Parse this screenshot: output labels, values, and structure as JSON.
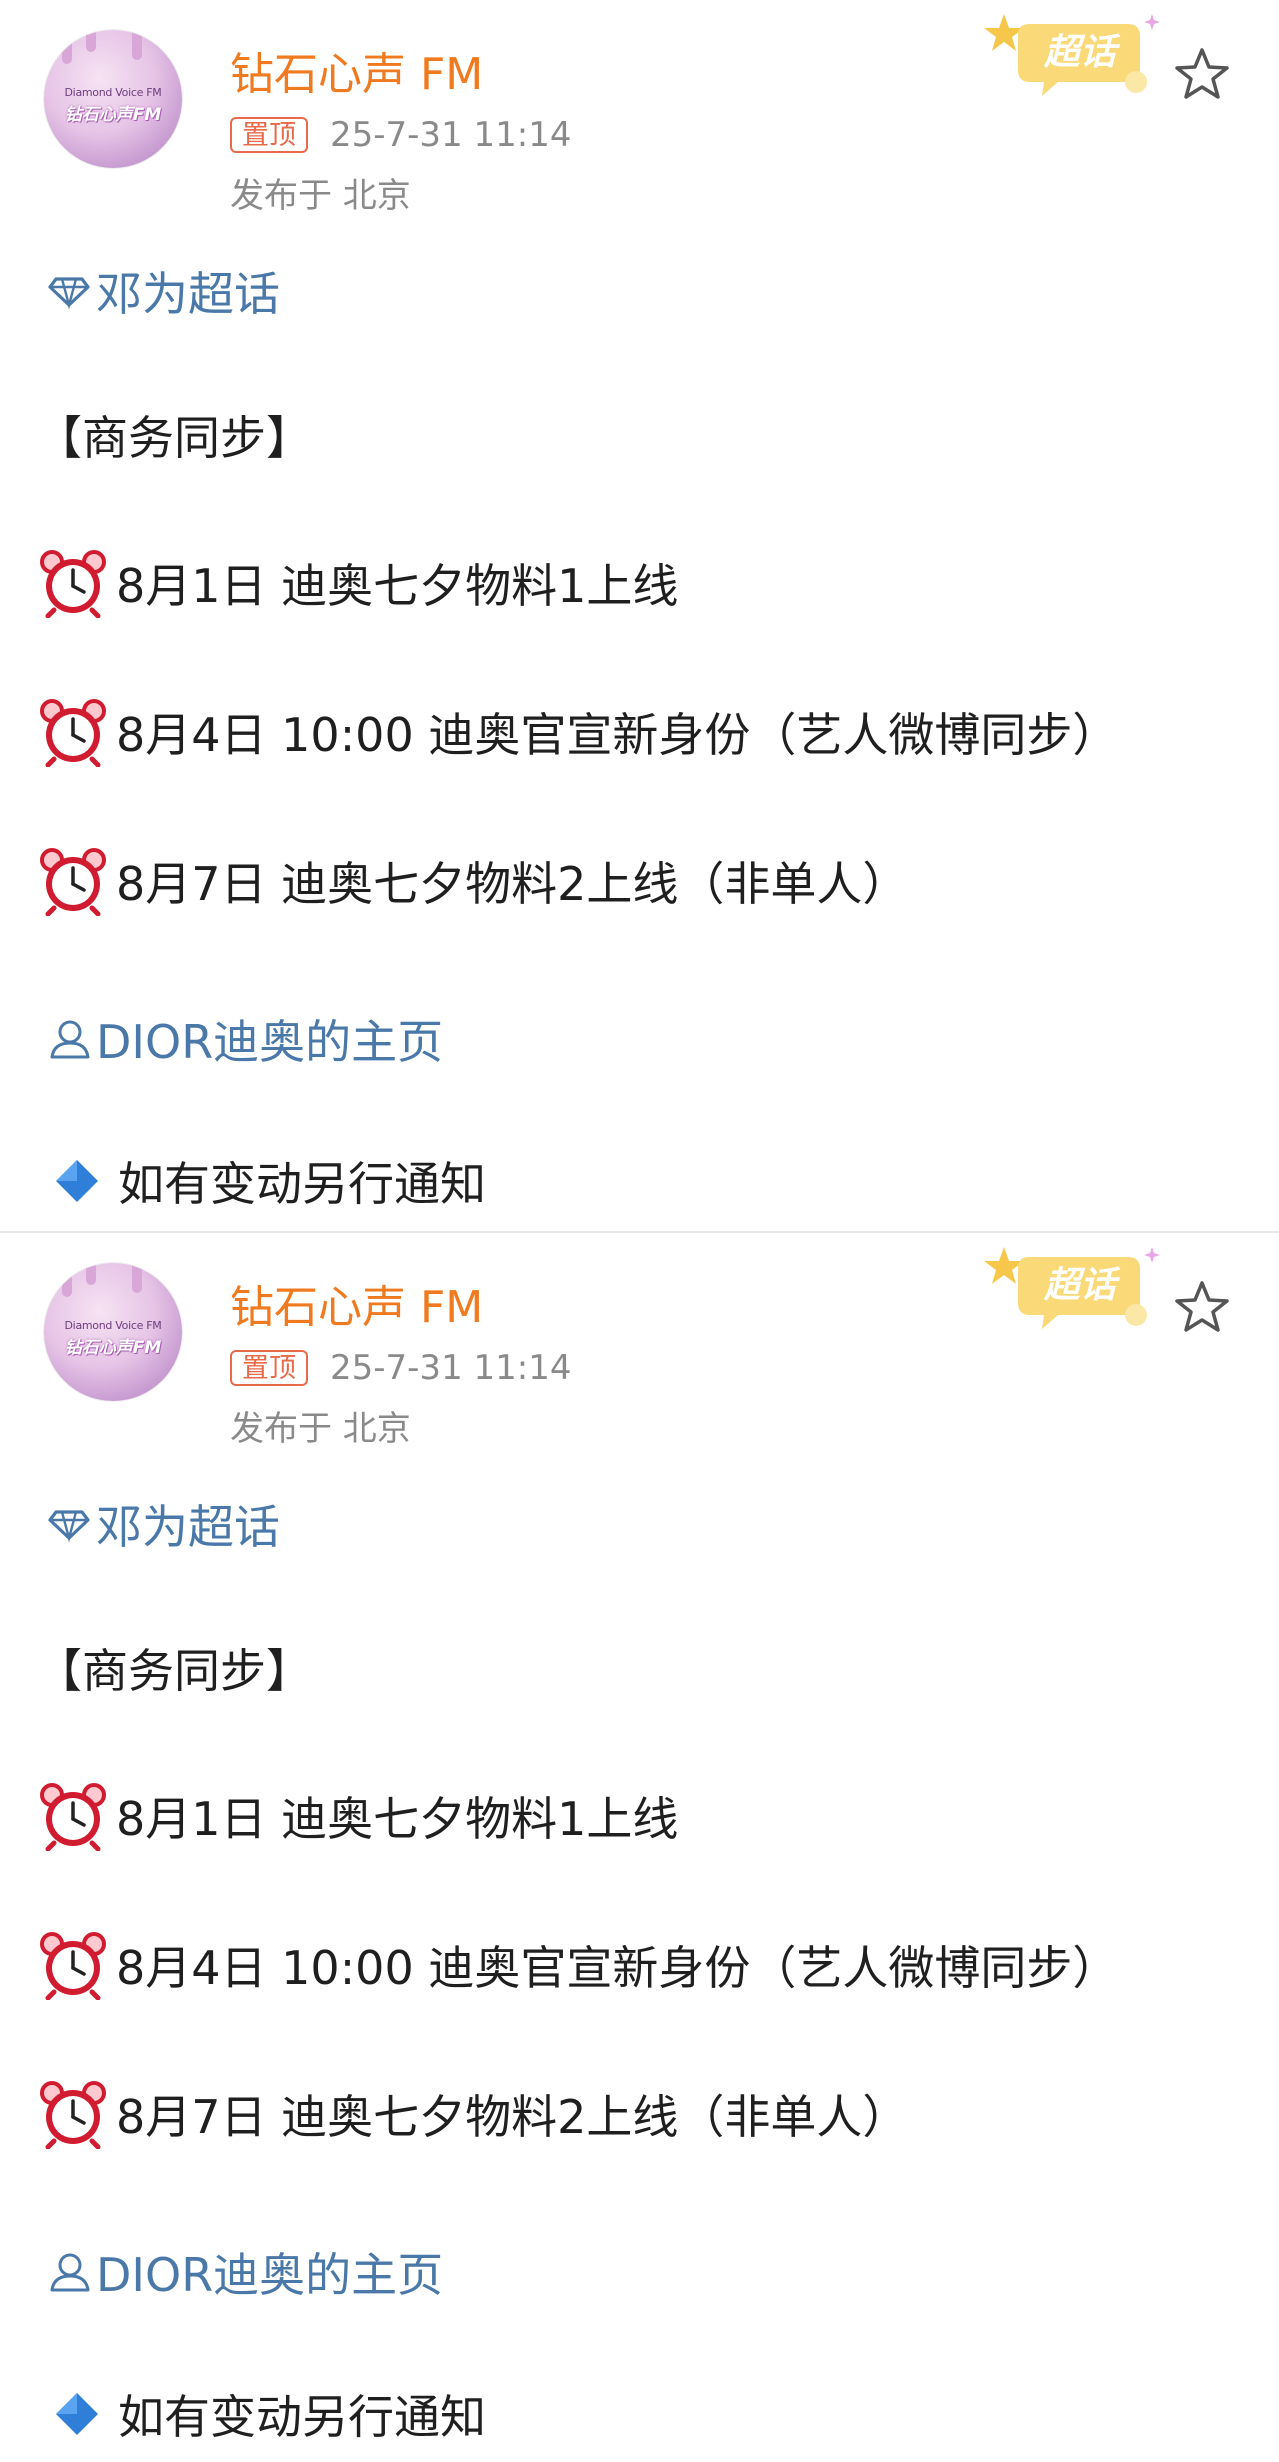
{
  "posts": [
    {
      "author": {
        "name": "钻石心声 FM",
        "avatar_line1": "Diamond Voice FM",
        "avatar_line2": "钻石心声FM"
      },
      "pin_label": "置顶",
      "timestamp": "25-7-31 11:14",
      "location": "发布于 北京",
      "badge_label": "超话",
      "topic": "邓为超话",
      "header": "【商务同步】",
      "schedule": [
        {
          "text": "8月1日 迪奥七夕物料1上线"
        },
        {
          "text": "8月4日 10:00 迪奥官宣新身份（艺人微博同步）"
        },
        {
          "text": "8月7日 迪奥七夕物料2上线（非单人）"
        }
      ],
      "profile_link": "DIOR迪奥的主页",
      "notice": "如有变动另行通知"
    },
    {
      "author": {
        "name": "钻石心声 FM",
        "avatar_line1": "Diamond Voice FM",
        "avatar_line2": "钻石心声FM"
      },
      "pin_label": "置顶",
      "timestamp": "25-7-31 11:14",
      "location": "发布于 北京",
      "badge_label": "超话",
      "topic": "邓为超话",
      "header": "【商务同步】",
      "schedule": [
        {
          "text": "8月1日 迪奥七夕物料1上线"
        },
        {
          "text": "8月4日 10:00 迪奥官宣新身份（艺人微博同步）"
        },
        {
          "text": "8月7日 迪奥七夕物料2上线（非单人）"
        }
      ],
      "profile_link": "DIOR迪奥的主页",
      "notice": "如有变动另行通知"
    }
  ],
  "icons": {
    "clock": "alarm-clock-icon",
    "diamond": "blue-diamond-icon",
    "topic": "diamond-outline-icon",
    "profile": "person-icon",
    "favorite": "star-icon"
  },
  "colors": {
    "author": "#f07a1f",
    "pin": "#e86a4a",
    "link": "#4a78a8",
    "meta": "#8a8a8a",
    "badge": "#f6c74a"
  }
}
